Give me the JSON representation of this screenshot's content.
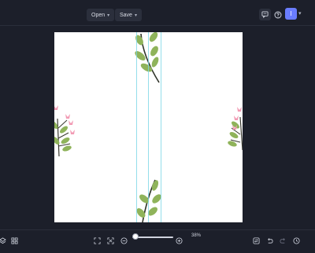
{
  "toolbar": {
    "open_label": "Open",
    "save_label": "Save",
    "avatar_initial": "I"
  },
  "icons": {
    "feedback": "feedback-icon",
    "help": "help-icon",
    "layers": "layers-icon",
    "grid": "grid-icon",
    "fit": "fit-screen-icon",
    "fullscreen": "fullscreen-icon",
    "zoom_out": "zoom-out-icon",
    "zoom_in": "zoom-in-icon",
    "swap": "swap-icon",
    "undo": "undo-icon",
    "redo": "redo-icon",
    "history": "history-icon"
  },
  "zoom": {
    "label": "38%"
  },
  "colors": {
    "accent": "#6a7dff",
    "guide": "#7ad6e6",
    "leaf": "#8fb35a",
    "flower": "#f29bb4"
  }
}
